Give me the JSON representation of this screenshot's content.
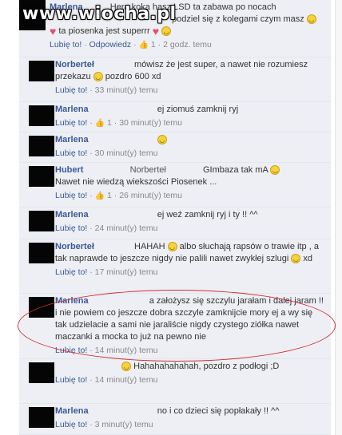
{
  "watermark": "www.wiocha.pl",
  "ui": {
    "like_label": "Lubię to!",
    "reply_label": "Odpowiedz",
    "sep": "·"
  },
  "comments": [
    {
      "author": "Marlena",
      "text_a": "Hera koka hasz LSD ta zabawa po nocach",
      "text_b": "podziel się z kolegami czym masz",
      "text_c": "ta piosenka jest superrr",
      "likes": "1",
      "time": "2 godz. temu"
    },
    {
      "author": "Norberteł",
      "text": "mówisz że jest super, a nawet nie rozumiesz przekazu",
      "text_after": "pozdro 600 xd",
      "time": "33 minut(y) temu"
    },
    {
      "author": "Marlena",
      "text": "ej ziomuś zamknij ryj",
      "likes": "1",
      "time": "30 minut(y) temu"
    },
    {
      "author": "Marlena",
      "time": "30 minut(y) temu"
    },
    {
      "author": "Hubert",
      "tag": "Norberteł",
      "text": "GImbaza tak mA",
      "line2": "Nawet nie wiedzą wiekszości Piosenek ...",
      "likes": "1",
      "time": "26 minut(y) temu"
    },
    {
      "author": "Marlena",
      "text": "ej weź zamknij ryj i ty !! ^^",
      "time": "24 minut(y) temu"
    },
    {
      "author": "Norberteł",
      "text": "HAHAH",
      "text_after": "albo słuchają rapsów o trawie itp , a tak naprawde to jeszcze nigdy nie palili nawet zwykłej szlugi",
      "text_end": "xd",
      "time": "17 minut(y) temu"
    },
    {
      "author": "Marlena",
      "text": "a założysz się szczylu jarałam i dalej jaram !! i nie powiem co jeszcze dobra szczyle zamknijcie mory ej a wy się tak udzielacie a sami nie jaraliście nigdy czystego ziółka nawet maczanki a mocka to już na pewno nie",
      "time": "14 minut(y) temu"
    },
    {
      "author": "",
      "text": "Hahahahahahah, pozdro z podłogi ;D",
      "time": "14 minut(y) temu"
    },
    {
      "author": "Marlena",
      "text": "no i co dzieci się popłakały !! ^^",
      "time": "3 minut(y) temu"
    }
  ]
}
